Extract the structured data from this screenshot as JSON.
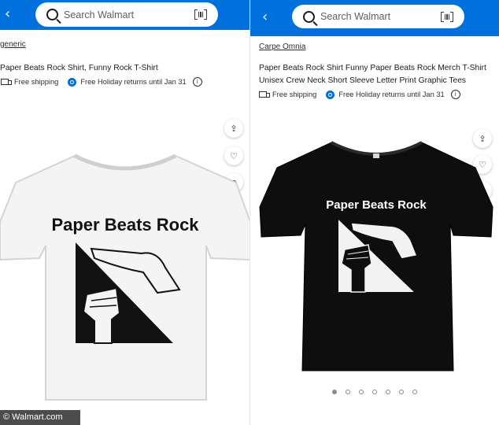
{
  "left": {
    "search_placeholder": "Search Walmart",
    "brand": "generic",
    "title": "Paper Beats Rock Shirt, Funny Rock T-Shirt",
    "shipping": "Free shipping",
    "returns": "Free Holiday returns until Jan 31",
    "shirt_text": "Paper Beats Rock",
    "shirt_color": "#ffffff"
  },
  "right": {
    "search_placeholder": "Search Walmart",
    "brand": "Carpe Omnia",
    "title_line1": "Paper Beats Rock Shirt Funny Paper Beats Rock Merch T-Shirt",
    "title_line2": "Unisex Crew Neck Short Sleeve Letter Print Graphic Tees",
    "shipping": "Free shipping",
    "returns": "Free Holiday returns until Jan 31",
    "shirt_text": "Paper Beats Rock",
    "shirt_color": "#0e0e0e",
    "carousel_total": 7,
    "carousel_active": 1
  },
  "credit": "© Walmart.com",
  "colors": {
    "walmart_blue": "#0071dc"
  }
}
